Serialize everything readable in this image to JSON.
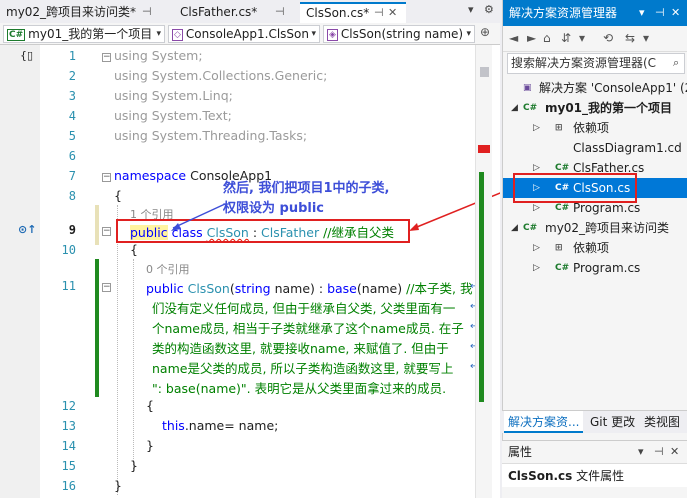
{
  "tabs": [
    {
      "label": "my02_跨项目来访问类*",
      "active": false
    },
    {
      "label": "ClsFather.cs*",
      "active": false
    },
    {
      "label": "ClsSon.cs*",
      "active": true
    }
  ],
  "navbar": {
    "project": "my01_我的第一个项目",
    "class": "ConsoleApp1.ClsSon",
    "member": "ClsSon(string name)"
  },
  "editor": {
    "line_numbers": [
      "1",
      "2",
      "3",
      "4",
      "5",
      "6",
      "7",
      "8",
      "9",
      "10",
      "11",
      "12",
      "13",
      "14",
      "15",
      "16"
    ],
    "usings": [
      {
        "kw": "using",
        "ns": "System;"
      },
      {
        "kw": "using",
        "ns": "System.Collections.Generic;"
      },
      {
        "kw": "using",
        "ns": "System.Linq;"
      },
      {
        "kw": "using",
        "ns": "System.Text;"
      },
      {
        "kw": "using",
        "ns": "System.Threading.Tasks;"
      }
    ],
    "namespace_kw": "namespace",
    "namespace_name": "ConsoleApp1",
    "open_brace": "{",
    "close_brace": "}",
    "refs_class": "1 个引用",
    "refs_ctor": "0 个引用",
    "class_line": {
      "public": "public",
      "class": "class",
      "name": "ClsSon",
      "colon": " : ",
      "base": "ClsFather",
      "comment": " //继承自父类"
    },
    "ctor_line": {
      "public": "public",
      "name": "ClsSon",
      "paren_open": "(",
      "string_kw": "string",
      "param": " name) : ",
      "base_kw": "base",
      "base_args": "(name) ",
      "comment": "//本子类, 我"
    },
    "comment_wrap": [
      "们没有定义任何成员, 但由于继承自父类, 父类里面有一",
      "个name成员, 相当于子类就继承了这个name成员. 在子",
      "类的构造函数这里, 就要接收name, 来赋值了. 但由于",
      "name是父类的成员, 所以子类构造函数这里, 就要写上",
      "\": base(name)\". 表明它是从父类里面拿过来的成员."
    ],
    "body_line": {
      "this_kw": "this",
      "rest": ".name= name;"
    },
    "annotation": [
      "然后, 我们把项目1中的子类,",
      "权限设为 public"
    ]
  },
  "solution_explorer": {
    "title": "解决方案资源管理器",
    "search_placeholder": "搜索解决方案资源管理器(C",
    "items": [
      {
        "label": "解决方案 'ConsoleApp1' (2"
      },
      {
        "label": "my01_我的第一个项目"
      },
      {
        "label": "依赖项"
      },
      {
        "label": "ClassDiagram1.cd"
      },
      {
        "label": "ClsFather.cs"
      },
      {
        "label": "ClsSon.cs"
      },
      {
        "label": "Program.cs"
      },
      {
        "label": "my02_跨项目来访问类"
      },
      {
        "label": "依赖项"
      },
      {
        "label": "Program.cs"
      }
    ],
    "bottom_tabs": [
      "解决方案资...",
      "Git 更改",
      "类视图"
    ]
  },
  "properties": {
    "title": "属性",
    "object_name": "ClsSon.cs",
    "object_type": "文件属性"
  },
  "colors": {
    "accent": "#007acc",
    "annotation_text": "#3d4ed8",
    "highlight_box": "#e02020",
    "change_bar": "#1f8a1f"
  },
  "icons": [
    "pin-icon",
    "close-icon",
    "dropdown-icon",
    "home-icon",
    "back-icon",
    "forward-icon",
    "refresh-icon",
    "settings-icon",
    "csharp-file-icon",
    "project-icon",
    "solution-icon",
    "dependencies-icon",
    "diagram-icon",
    "fold-icon",
    "references-icon",
    "wrap-icon"
  ]
}
